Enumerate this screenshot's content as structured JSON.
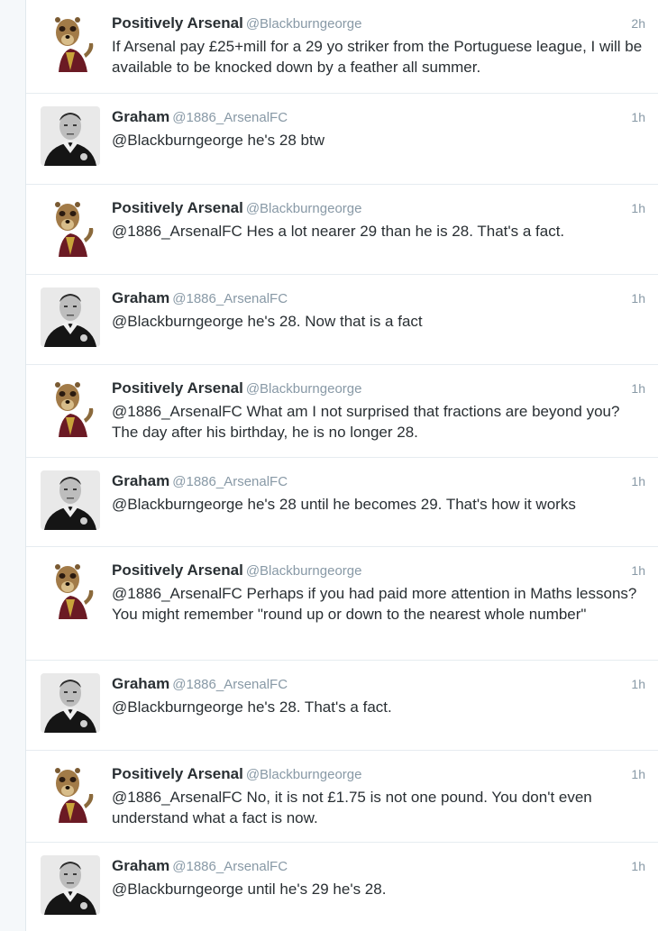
{
  "users": {
    "positively": {
      "display_name": "Positively Arsenal",
      "handle": "@Blackburngeorge",
      "avatar_icon": "meerkat-avatar-icon"
    },
    "graham": {
      "display_name": "Graham",
      "handle": "@1886_ArsenalFC",
      "avatar_icon": "referee-avatar-icon"
    }
  },
  "tweets": [
    {
      "display_name": "Positively Arsenal",
      "handle": "@Blackburngeorge",
      "time": "2h",
      "text": "If Arsenal pay £25+mill for a 29 yo striker from the  Portuguese league, I will be available to be knocked down by a feather all summer."
    },
    {
      "display_name": "Graham",
      "handle": "@1886_ArsenalFC",
      "time": "1h",
      "text": "@Blackburngeorge he's 28 btw"
    },
    {
      "display_name": "Positively Arsenal",
      "handle": "@Blackburngeorge",
      "time": "1h",
      "text": "@1886_ArsenalFC Hes a lot nearer 29 than he is 28. That's a fact."
    },
    {
      "display_name": "Graham",
      "handle": "@1886_ArsenalFC",
      "time": "1h",
      "text": "@Blackburngeorge he's 28. Now that is a fact"
    },
    {
      "display_name": "Positively Arsenal",
      "handle": "@Blackburngeorge",
      "time": "1h",
      "text": "@1886_ArsenalFC  What am I not surprised that fractions are beyond you? The day after his birthday, he is no longer 28."
    },
    {
      "display_name": "Graham",
      "handle": "@1886_ArsenalFC",
      "time": "1h",
      "text": "@Blackburngeorge he's 28 until he becomes 29. That's how it works"
    },
    {
      "display_name": "Positively Arsenal",
      "handle": "@Blackburngeorge",
      "time": "1h",
      "text": "@1886_ArsenalFC Perhaps if you had paid more attention in Maths lessons? You might remember \"round up or down to the nearest whole number\""
    },
    {
      "display_name": "Graham",
      "handle": "@1886_ArsenalFC",
      "time": "1h",
      "text": "@Blackburngeorge he's 28. That's a fact."
    },
    {
      "display_name": "Positively Arsenal",
      "handle": "@Blackburngeorge",
      "time": "1h",
      "text": "@1886_ArsenalFC No, it is not £1.75 is not one pound. You don't even understand what a fact is now."
    },
    {
      "display_name": "Graham",
      "handle": "@1886_ArsenalFC",
      "time": "1h",
      "text": "@Blackburngeorge until he's 29 he's 28."
    }
  ]
}
